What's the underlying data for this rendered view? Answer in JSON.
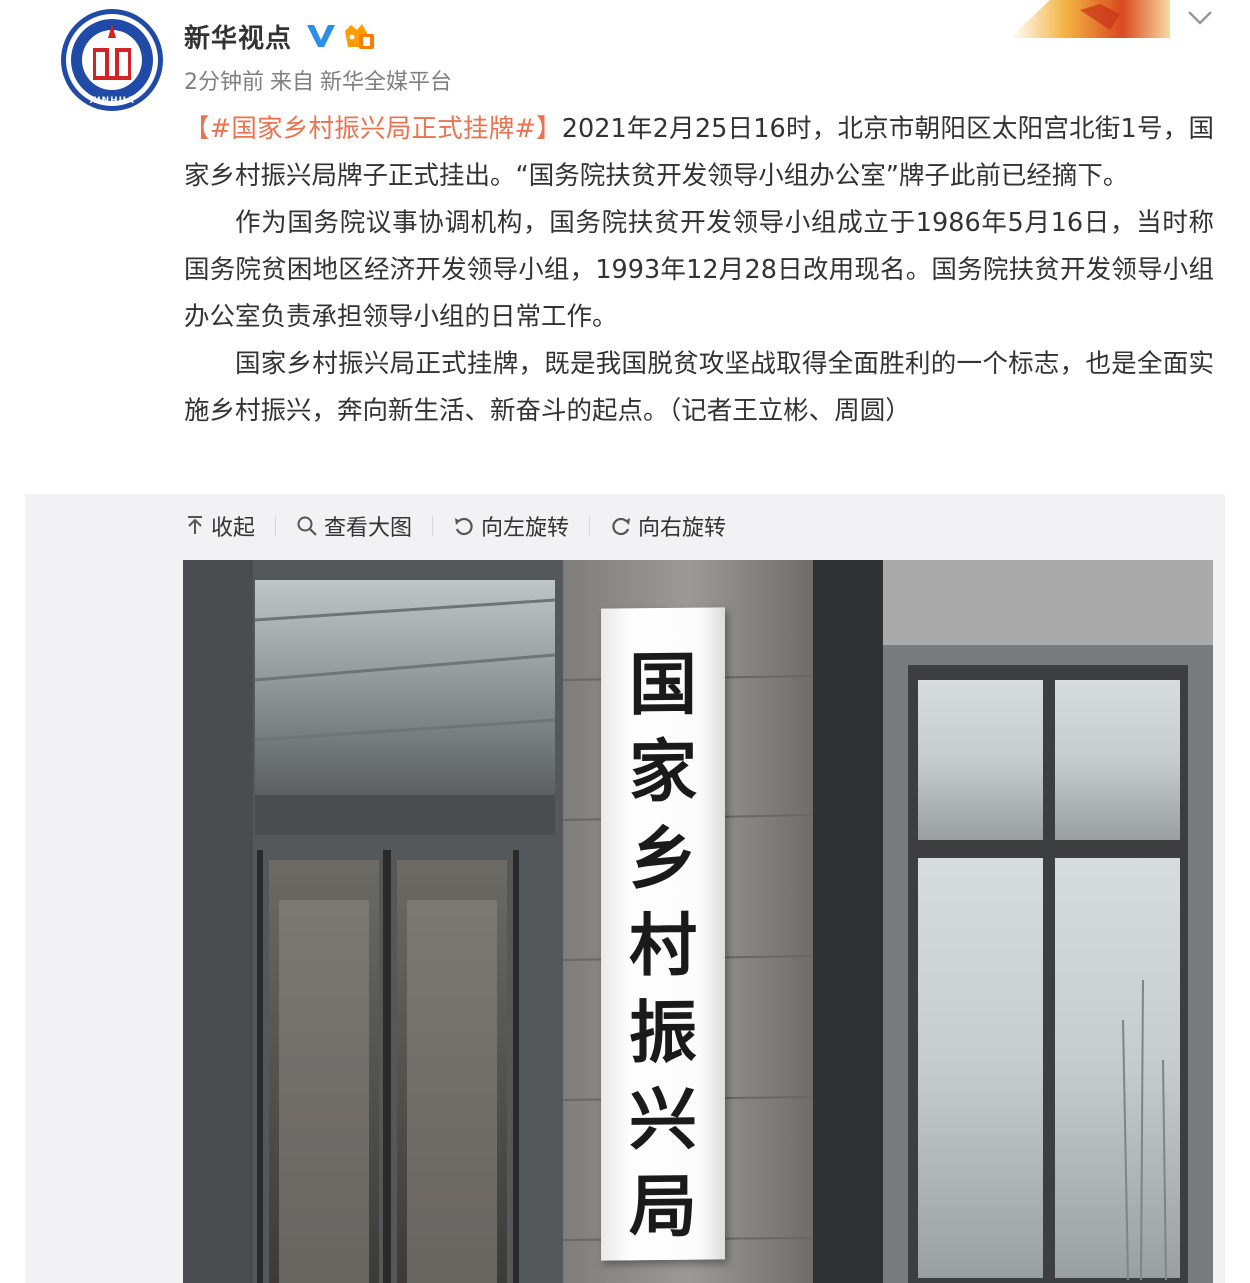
{
  "user": {
    "name": "新华视点",
    "time": "2分钟前",
    "source_prefix": "来自",
    "source": "新华全媒平台"
  },
  "avatar": {
    "label": "XINHUA"
  },
  "post": {
    "hashtag": "【#国家乡村振兴局正式挂牌#】",
    "paragraph1": "2021年2月25日16时，北京市朝阳区太阳宫北街1号，国家乡村振兴局牌子正式挂出。“国务院扶贫开发领导小组办公室”牌子此前已经摘下。",
    "paragraph2": "作为国务院议事协调机构，国务院扶贫开发领导小组成立于1986年5月16日，当时称国务院贫困地区经济开发领导小组，1993年12月28日改用现名。国务院扶贫开发领导小组办公室负责承担领导小组的日常工作。",
    "paragraph3": "国家乡村振兴局正式挂牌，既是我国脱贫攻坚战取得全面胜利的一个标志，也是全面实施乡村振兴，奔向新生活、新奋斗的起点。（记者王立彬、周圆）"
  },
  "toolbar": {
    "collapse": "收起",
    "view_large": "查看大图",
    "rotate_left": "向左旋转",
    "rotate_right": "向右旋转"
  },
  "photo": {
    "sign_chars": [
      "国",
      "家",
      "乡",
      "村",
      "振",
      "兴",
      "局"
    ]
  },
  "icons": {
    "verified": "verified-v-icon",
    "member": "member-crown-icon",
    "more": "chevron-down-icon",
    "collapse": "arrow-up-icon",
    "view_large": "magnifier-icon",
    "rotate_left": "rotate-left-icon",
    "rotate_right": "rotate-right-icon"
  },
  "colors": {
    "hashtag": "#eb7350",
    "verified": "#2b8fea",
    "member": "#ff9d00",
    "text": "#333333",
    "meta": "#808080",
    "panel": "#f2f2f5"
  }
}
